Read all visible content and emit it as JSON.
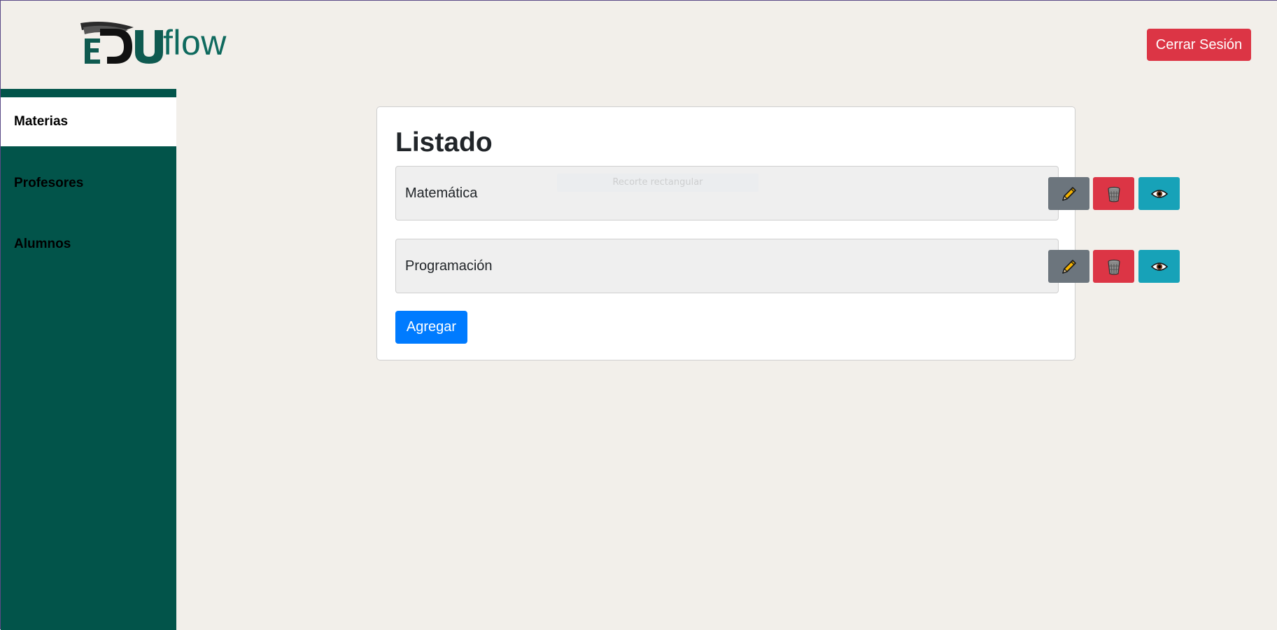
{
  "header": {
    "logo_text": "flow",
    "logout_label": "Cerrar Sesión"
  },
  "sidebar": {
    "items": [
      {
        "label": "Materias",
        "active": true
      },
      {
        "label": "Profesores",
        "active": false
      },
      {
        "label": "Alumnos",
        "active": false
      }
    ]
  },
  "main": {
    "title": "Listado",
    "items": [
      {
        "name": "Matemática"
      },
      {
        "name": "Programación"
      }
    ],
    "add_label": "Agregar",
    "ghost_tooltip": "Recorte rectangular"
  },
  "icons": {
    "edit": "pencil-icon",
    "delete": "trash-icon",
    "view": "eye-icon"
  },
  "colors": {
    "brand": "#02544a",
    "danger": "#dc3545",
    "secondary": "#6c757d",
    "info": "#17a2b8",
    "primary": "#007bff"
  }
}
